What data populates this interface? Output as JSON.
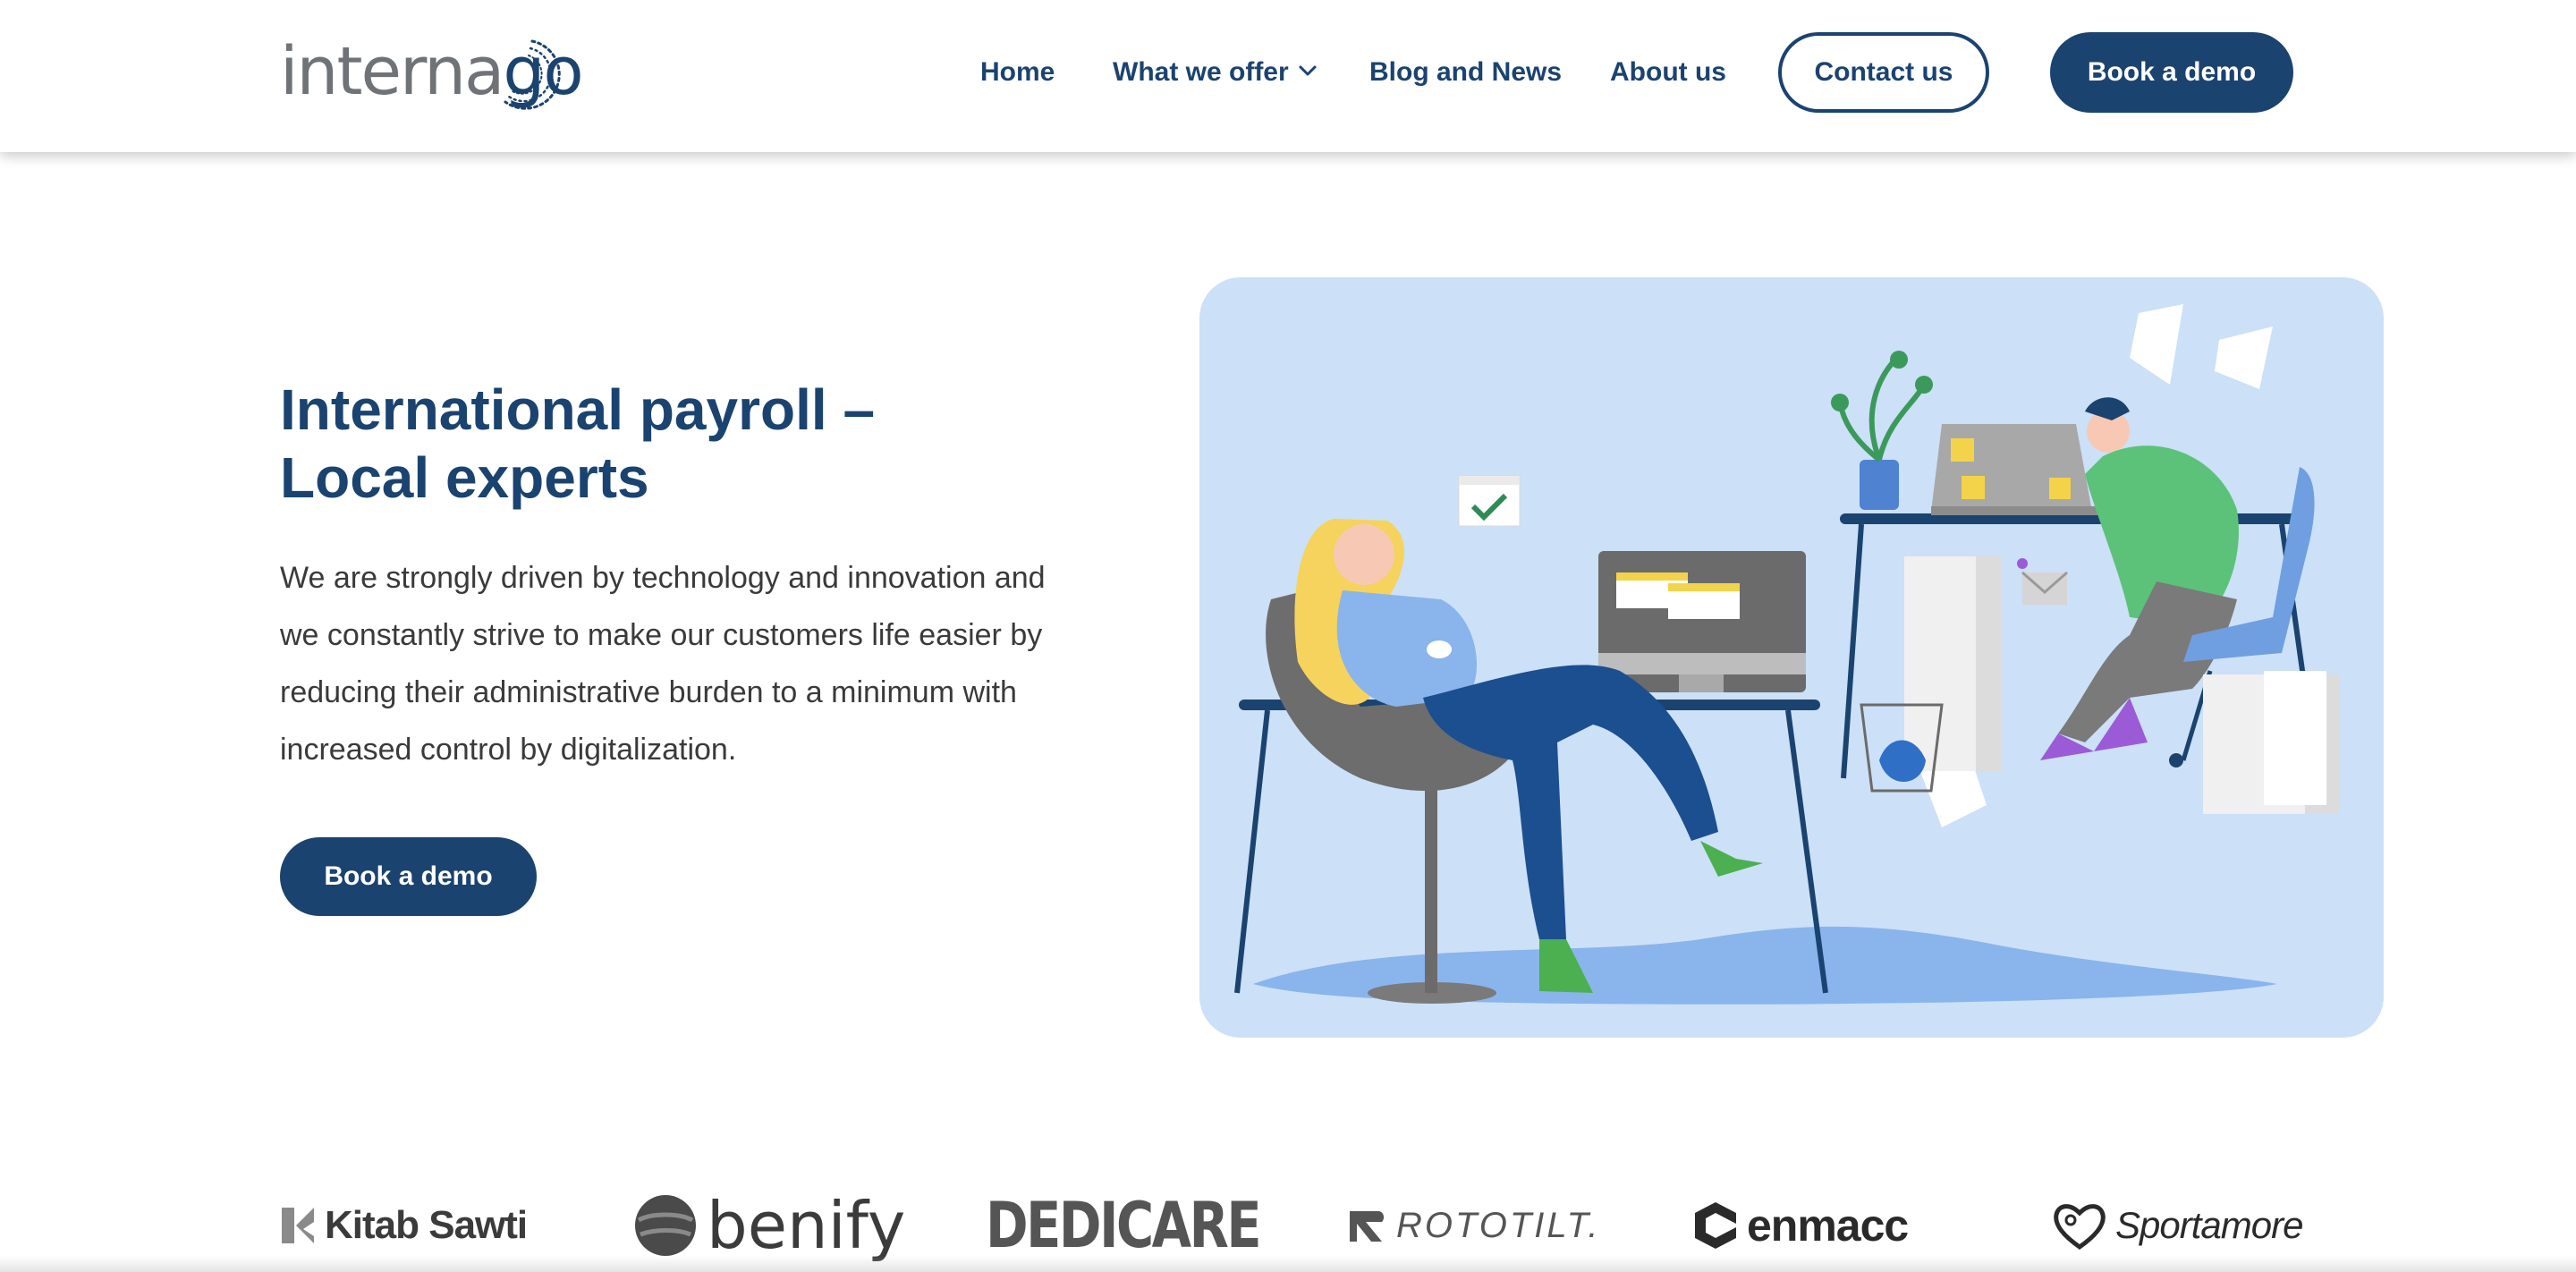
{
  "header": {
    "logo": {
      "prefix": "interna",
      "suffix": "go"
    },
    "nav": [
      {
        "label": "Home"
      },
      {
        "label": "What we offer",
        "has_dropdown": true
      },
      {
        "label": "Blog and News"
      },
      {
        "label": "About us"
      }
    ],
    "contact_label": "Contact us",
    "demo_label": "Book a demo"
  },
  "hero": {
    "title_line1": "International payroll –",
    "title_line2": "Local experts",
    "body": "We are strongly driven by technology and innovation and we constantly strive to make our customers life easier by reducing their administrative burden to a minimum with increased control by digitalization.",
    "cta_label": "Book a demo"
  },
  "client_logos": [
    {
      "name": "Kitab Sawti"
    },
    {
      "name": "benify"
    },
    {
      "name": "DEDICARE"
    },
    {
      "name": "ROTOTILT."
    },
    {
      "name": "enmacc"
    },
    {
      "name": "Sportamore"
    }
  ],
  "colors": {
    "brand_navy": "#1b4370",
    "illustration_bg": "#cce0f7",
    "floor_blue": "#8ab4ec",
    "body_text": "#3a3a3a"
  }
}
